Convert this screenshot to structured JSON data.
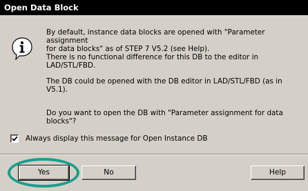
{
  "window": {
    "title": "Open Data Block"
  },
  "icons": {
    "info": "info-icon",
    "checkmark": "checkmark-icon"
  },
  "message": {
    "paragraph_1": "By default, instance data blocks are opened with \"Parameter assignment\nfor data blocks\" as of STEP 7 V5.2 (see Help).\nThere is no functional difference for this DB to the editor in\nLAD/STL/FBD.",
    "paragraph_2": "The DB could be opened with the DB editor in LAD/STL/FBD (as in\nV5.1).",
    "paragraph_3": "Do you want to open the DB with \"Parameter assignment for data\nblocks\"?"
  },
  "checkbox": {
    "label": "Always display this message for Open Instance DB",
    "checked": true
  },
  "buttons": {
    "yes": "Yes",
    "no": "No",
    "help": "Help"
  },
  "colors": {
    "titlebar": "#000000",
    "dialog_face": "#d4d0c8",
    "highlight_ring": "#1a9e8c"
  }
}
